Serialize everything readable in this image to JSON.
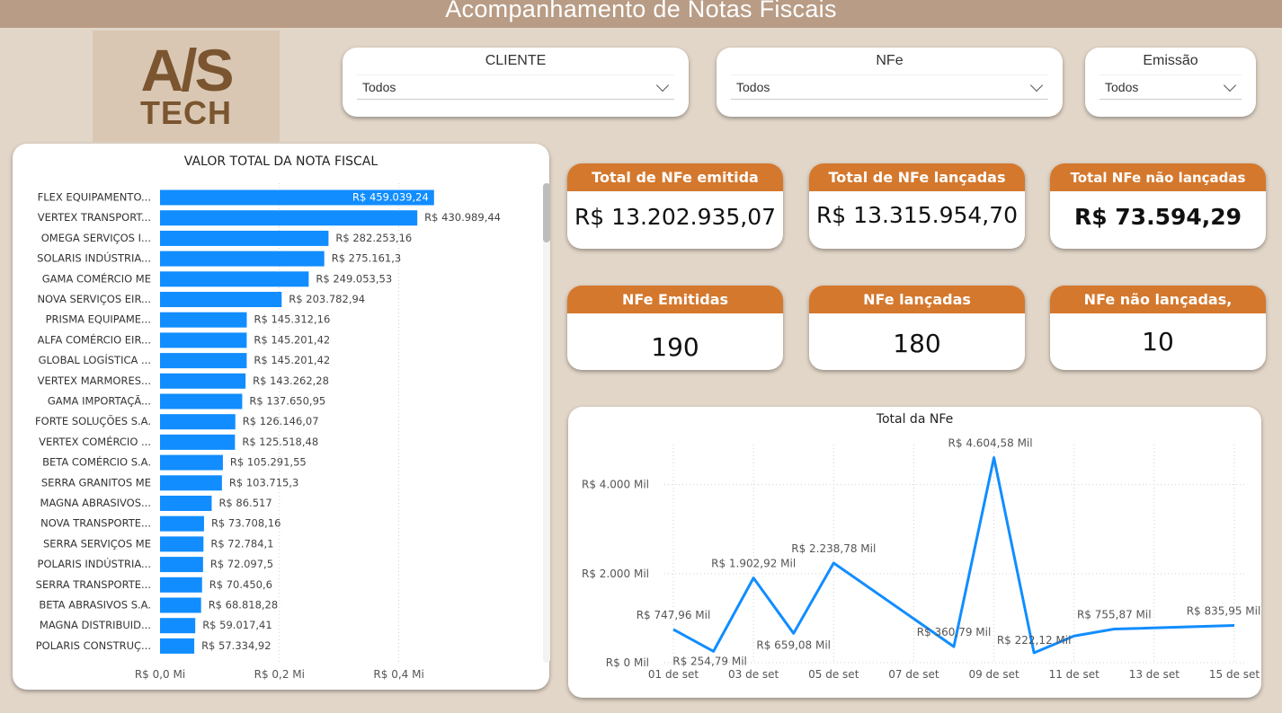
{
  "header": {
    "title": "Acompanhamento de Notas Fiscais"
  },
  "logo": {
    "line1": "A/S",
    "line2": "TECH"
  },
  "slicers": [
    {
      "label": "CLIENTE",
      "value": "Todos"
    },
    {
      "label": "NFe",
      "value": "Todos"
    },
    {
      "label": "Emissão",
      "value": "Todos"
    }
  ],
  "kpis": [
    {
      "label": "Total de NFe emitida",
      "value": "R$ 13.202.935,07"
    },
    {
      "label": "Total de NFe lançadas",
      "value": "R$ 13.315.954,70"
    },
    {
      "label": "Total NFe não lançadas",
      "value": "R$ 73.594,29"
    },
    {
      "label": "NFe Emitidas",
      "value": "190"
    },
    {
      "label": "NFe lançadas",
      "value": "180"
    },
    {
      "label": "NFe não lançadas,",
      "value": "10"
    }
  ],
  "colors": {
    "accent": "#d4782d",
    "bar": "#118dff",
    "header": "#b89c85",
    "background": "#e2d6c8"
  },
  "chart_data": [
    {
      "type": "bar",
      "orientation": "horizontal",
      "title": "VALOR TOTAL DA NOTA FISCAL",
      "categories": [
        "FLEX EQUIPAMENTO...",
        "VERTEX TRANSPORT...",
        "OMEGA SERVIÇOS I...",
        "SOLARIS INDÚSTRIA...",
        "GAMA COMÉRCIO ME",
        "NOVA SERVIÇOS EIR...",
        "PRISMA EQUIPAME...",
        "ALFA COMÉRCIO EIR...",
        "GLOBAL LOGÍSTICA ...",
        "VERTEX MARMORES...",
        "GAMA IMPORTAÇÃ...",
        "FORTE SOLUÇÕES S.A.",
        "VERTEX COMÉRCIO ...",
        "BETA COMÉRCIO S.A.",
        "SERRA GRANITOS ME",
        "MAGNA ABRASIVOS...",
        "NOVA TRANSPORTE...",
        "SERRA SERVIÇOS ME",
        "POLARIS INDÚSTRIA...",
        "SERRA TRANSPORTE...",
        "BETA ABRASIVOS S.A.",
        "MAGNA DISTRIBUID...",
        "POLARIS CONSTRUÇ..."
      ],
      "values": [
        459039.24,
        430989.44,
        282253.16,
        275161.3,
        249053.53,
        203782.94,
        145312.16,
        145201.42,
        145201.42,
        143262.28,
        137650.95,
        126146.07,
        125518.48,
        105291.55,
        103715.3,
        86517,
        73708.16,
        72784.1,
        72097.5,
        70450.6,
        68818.28,
        59017.41,
        57334.92
      ],
      "data_labels": [
        "R$ 459.039,24",
        "R$ 430.989,44",
        "R$ 282.253,16",
        "R$ 275.161,3",
        "R$ 249.053,53",
        "R$ 203.782,94",
        "R$ 145.312,16",
        "R$ 145.201,42",
        "R$ 145.201,42",
        "R$ 143.262,28",
        "R$ 137.650,95",
        "R$ 126.146,07",
        "R$ 125.518,48",
        "R$ 105.291,55",
        "R$ 103.715,3",
        "R$ 86.517",
        "R$ 73.708,16",
        "R$ 72.784,1",
        "R$ 72.097,5",
        "R$ 70.450,6",
        "R$ 68.818,28",
        "R$ 59.017,41",
        "R$ 57.334,92"
      ],
      "xlim": [
        0,
        500000
      ],
      "x_ticks": [
        0,
        200000,
        400000
      ],
      "x_tick_labels": [
        "R$ 0,0 Mi",
        "R$ 0,2 Mi",
        "R$ 0,4 Mi"
      ],
      "grid": true
    },
    {
      "type": "line",
      "title": "Total da NFe",
      "x": [
        1,
        2,
        3,
        4,
        5,
        8,
        9,
        10,
        11,
        12,
        15
      ],
      "values": [
        747.96,
        254.79,
        1902.92,
        659.08,
        2238.78,
        360.79,
        4604.58,
        222.12,
        600,
        755.87,
        835.95
      ],
      "point_labels": [
        {
          "x": 1,
          "text": "R$ 747,96 Mil"
        },
        {
          "x": 2,
          "text": "R$ 254,79 Mil"
        },
        {
          "x": 3,
          "text": "R$ 1.902,92 Mil"
        },
        {
          "x": 4,
          "text": "R$ 659,08 Mil"
        },
        {
          "x": 5,
          "text": "R$ 2.238,78 Mil"
        },
        {
          "x": 8,
          "text": "R$ 360,79 Mil"
        },
        {
          "x": 9,
          "text": "R$ 4.604,58 Mil"
        },
        {
          "x": 10,
          "text": "R$ 222,12 Mil"
        },
        {
          "x": 12,
          "text": "R$ 755,87 Mil"
        },
        {
          "x": 15,
          "text": "R$ 835,95 Mil"
        }
      ],
      "x_ticks": [
        1,
        3,
        5,
        7,
        9,
        11,
        13,
        15
      ],
      "x_tick_labels": [
        "01 de set",
        "03 de set",
        "05 de set",
        "07 de set",
        "09 de set",
        "11 de set",
        "13 de set",
        "15 de set"
      ],
      "y_ticks": [
        0,
        2000,
        4000
      ],
      "y_tick_labels": [
        "R$ 0 Mil",
        "R$ 2.000 Mil",
        "R$ 4.000 Mil"
      ],
      "xlim": [
        1,
        15
      ],
      "ylim": [
        0,
        4900
      ],
      "grid": true
    }
  ]
}
